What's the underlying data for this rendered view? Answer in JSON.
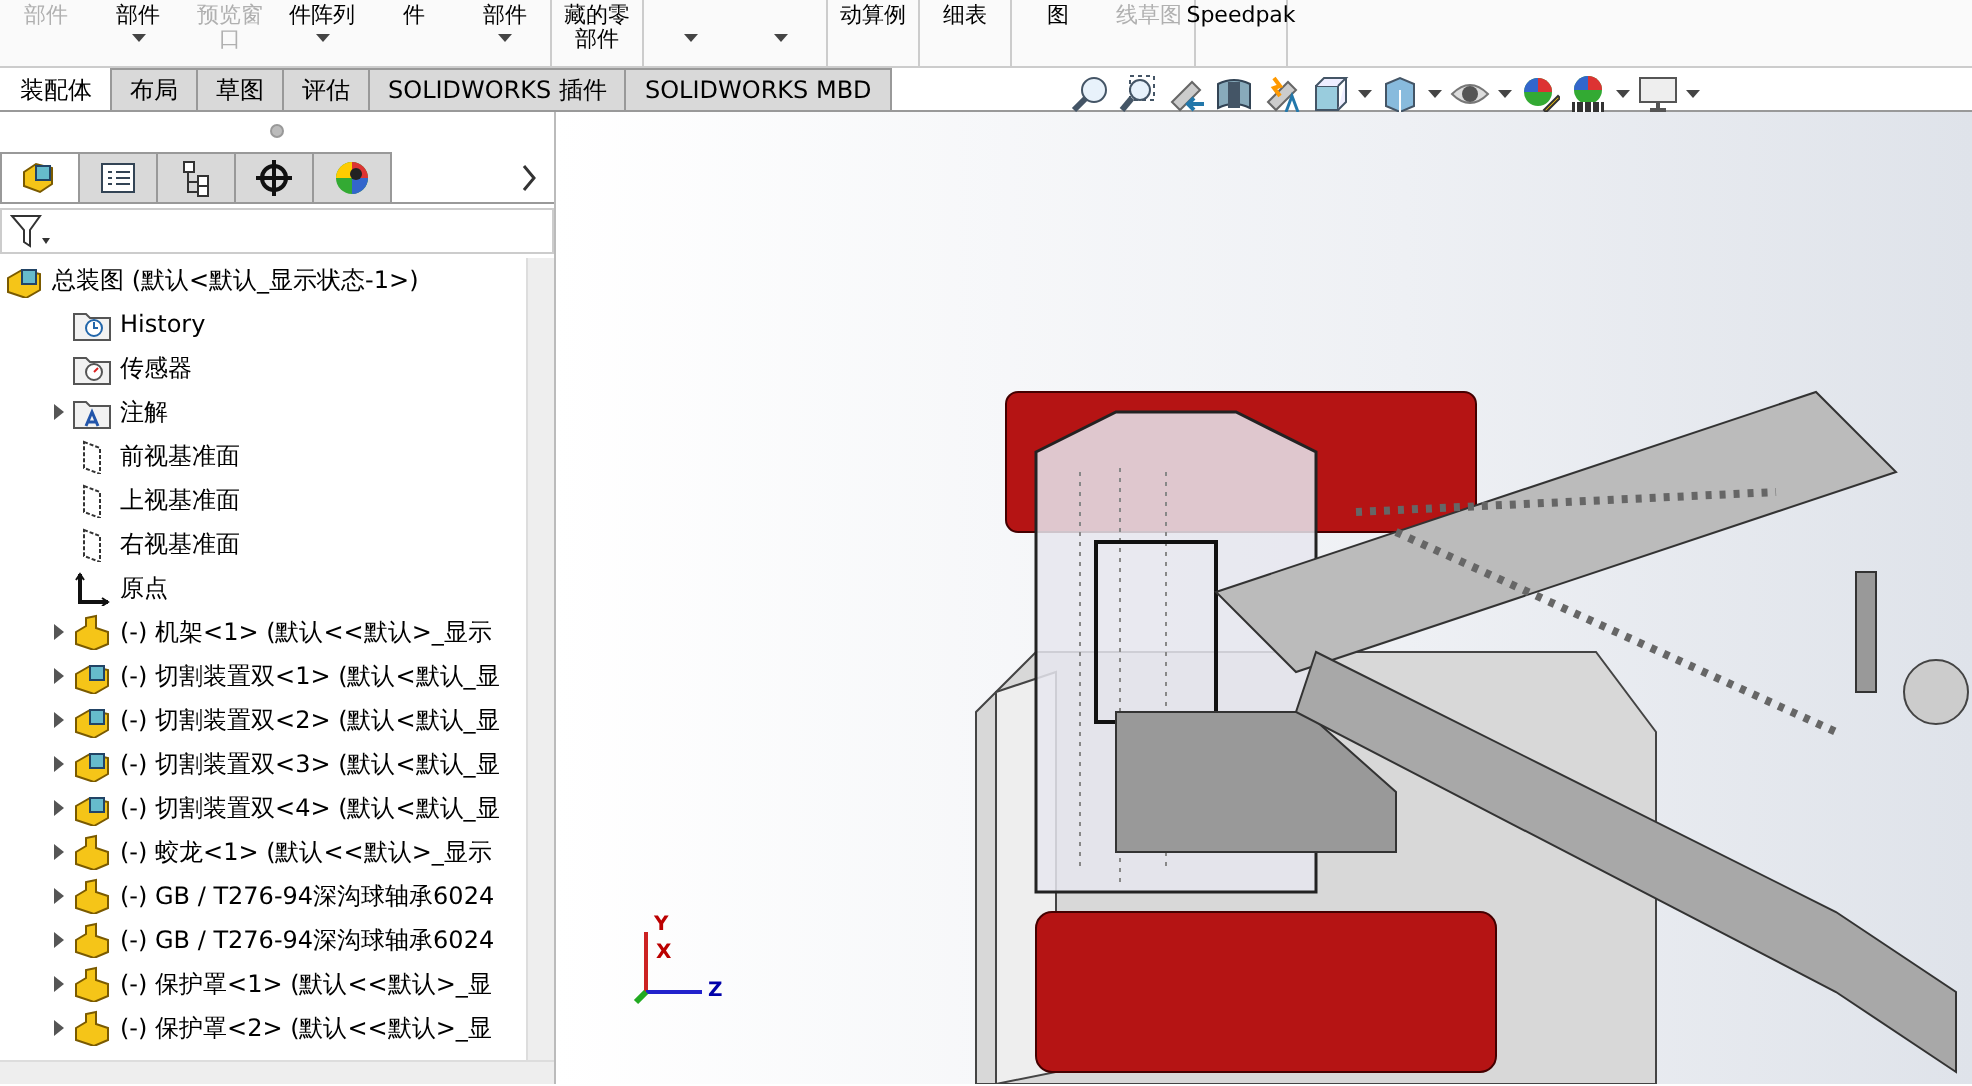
{
  "ribbon": [
    {
      "label": [
        "部件"
      ],
      "disabled": true,
      "caret": false,
      "separator_after": false
    },
    {
      "label": [
        "部件"
      ],
      "disabled": false,
      "caret": true,
      "separator_after": false
    },
    {
      "label": [
        "预览窗",
        "口"
      ],
      "disabled": true,
      "caret": false,
      "separator_after": false
    },
    {
      "label": [
        "件阵列"
      ],
      "disabled": false,
      "caret": true,
      "separator_after": false
    },
    {
      "label": [
        "件"
      ],
      "disabled": false,
      "caret": false,
      "separator_after": false
    },
    {
      "label": [
        "部件"
      ],
      "disabled": false,
      "caret": true,
      "separator_after": true
    },
    {
      "label": [
        "藏的零",
        "部件"
      ],
      "disabled": false,
      "caret": false,
      "separator_after": true
    },
    {
      "disabled": false,
      "caret": true,
      "separator_after": false
    },
    {
      "disabled": false,
      "caret": true,
      "separator_after": true
    },
    {
      "label": [
        "动算例"
      ],
      "disabled": false,
      "caret": false,
      "separator_after": true
    },
    {
      "label": [
        "细表"
      ],
      "disabled": false,
      "caret": false,
      "separator_after": true
    },
    {
      "label": [
        "图"
      ],
      "disabled": false,
      "caret": false,
      "separator_after": false
    },
    {
      "label": [
        "线草图"
      ],
      "disabled": true,
      "caret": false,
      "separator_after": true
    },
    {
      "label": [
        "Speedpak"
      ],
      "disabled": false,
      "caret": false,
      "separator_after": true
    }
  ],
  "tabs": [
    {
      "label": "装配体",
      "selected": true
    },
    {
      "label": "布局",
      "selected": false
    },
    {
      "label": "草图",
      "selected": false
    },
    {
      "label": "评估",
      "selected": false
    },
    {
      "label": "SOLIDWORKS 插件",
      "selected": false
    },
    {
      "label": "SOLIDWORKS MBD",
      "selected": false
    }
  ],
  "view_toolbar": [
    {
      "kind": "zoom-fit",
      "caret": false
    },
    {
      "kind": "zoom-area",
      "caret": false
    },
    {
      "kind": "previous-view",
      "caret": false
    },
    {
      "kind": "section-view",
      "caret": false
    },
    {
      "kind": "dynamic-annotation",
      "caret": false
    },
    {
      "kind": "view-orientation",
      "caret": true
    },
    {
      "kind": "display-style",
      "caret": true
    },
    {
      "kind": "hide-show",
      "caret": true
    },
    {
      "kind": "edit-appearance",
      "caret": false
    },
    {
      "kind": "apply-scene",
      "caret": true
    },
    {
      "kind": "view-settings",
      "caret": true
    }
  ],
  "panel_tabs": [
    {
      "kind": "feature-manager",
      "selected": true
    },
    {
      "kind": "property-manager",
      "selected": false
    },
    {
      "kind": "configuration-manager",
      "selected": false
    },
    {
      "kind": "dimxpert-manager",
      "selected": false
    },
    {
      "kind": "display-manager",
      "selected": false
    }
  ],
  "tree": [
    {
      "kind": "assembly",
      "label": "总装图  (默认<默认_显示状态-1>)",
      "expandable": false,
      "children": [
        {
          "kind": "history",
          "label": "History",
          "expandable": false
        },
        {
          "kind": "sensor",
          "label": "传感器",
          "expandable": false
        },
        {
          "kind": "annotation",
          "label": "注解",
          "expandable": true
        },
        {
          "kind": "plane",
          "label": "前视基准面",
          "expandable": false
        },
        {
          "kind": "plane",
          "label": "上视基准面",
          "expandable": false
        },
        {
          "kind": "plane",
          "label": "右视基准面",
          "expandable": false
        },
        {
          "kind": "origin",
          "label": "原点",
          "expandable": false
        },
        {
          "kind": "part",
          "label": "(-) 机架<1> (默认<<默认>_显示",
          "expandable": true
        },
        {
          "kind": "subassembly",
          "label": "(-) 切割装置双<1> (默认<默认_显",
          "expandable": true
        },
        {
          "kind": "subassembly",
          "label": "(-) 切割装置双<2> (默认<默认_显",
          "expandable": true
        },
        {
          "kind": "subassembly",
          "label": "(-) 切割装置双<3> (默认<默认_显",
          "expandable": true
        },
        {
          "kind": "subassembly",
          "label": "(-) 切割装置双<4> (默认<默认_显",
          "expandable": true
        },
        {
          "kind": "part",
          "label": "(-) 蛟龙<1> (默认<<默认>_显示",
          "expandable": true
        },
        {
          "kind": "part",
          "label": "(-) GB / T276-94深沟球轴承6024",
          "expandable": true
        },
        {
          "kind": "part",
          "label": "(-) GB / T276-94深沟球轴承6024",
          "expandable": true
        },
        {
          "kind": "part",
          "label": "(-) 保护罩<1> (默认<<默认>_显",
          "expandable": true
        },
        {
          "kind": "part",
          "label": "(-) 保护罩<2> (默认<<默认>_显",
          "expandable": true
        }
      ]
    }
  ],
  "triad": {
    "x": "X",
    "y": "Y",
    "z": "Z"
  }
}
